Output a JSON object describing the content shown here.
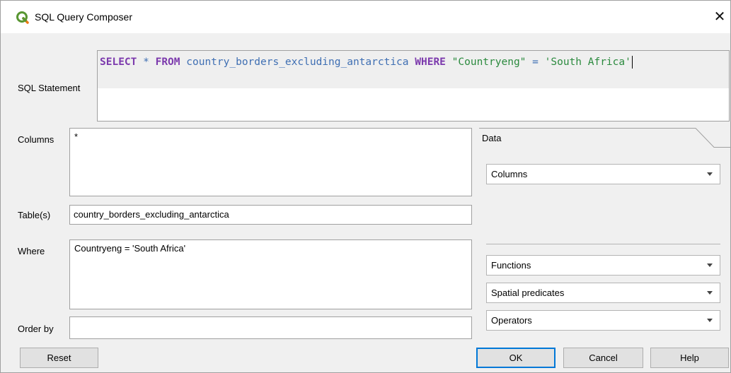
{
  "window": {
    "title": "SQL Query Composer",
    "close_glyph": "✕"
  },
  "sql": {
    "label": "SQL Statement",
    "kw_select": "SELECT",
    "star": "*",
    "kw_from": "FROM",
    "table": "country_borders_excluding_antarctica",
    "kw_where": "WHERE",
    "field": "\"Countryeng\"",
    "eq": "=",
    "value": "'South Africa'"
  },
  "columns": {
    "label": "Columns",
    "value": "*"
  },
  "tables": {
    "label": "Table(s)",
    "value": "country_borders_excluding_antarctica"
  },
  "where": {
    "label": "Where",
    "value": "Countryeng = 'South Africa'"
  },
  "orderby": {
    "label": "Order by",
    "value": ""
  },
  "data_panel": {
    "tab_label": "Data",
    "columns_combo": "Columns",
    "functions_combo": "Functions",
    "spatial_combo": "Spatial predicates",
    "operators_combo": "Operators"
  },
  "buttons": {
    "reset": "Reset",
    "ok": "OK",
    "cancel": "Cancel",
    "help": "Help"
  },
  "colors": {
    "keyword": "#7c3aad",
    "identifier": "#3f6fb3",
    "string": "#2b8a3e",
    "accent": "#0078d7",
    "qgis_green": "#589632"
  }
}
